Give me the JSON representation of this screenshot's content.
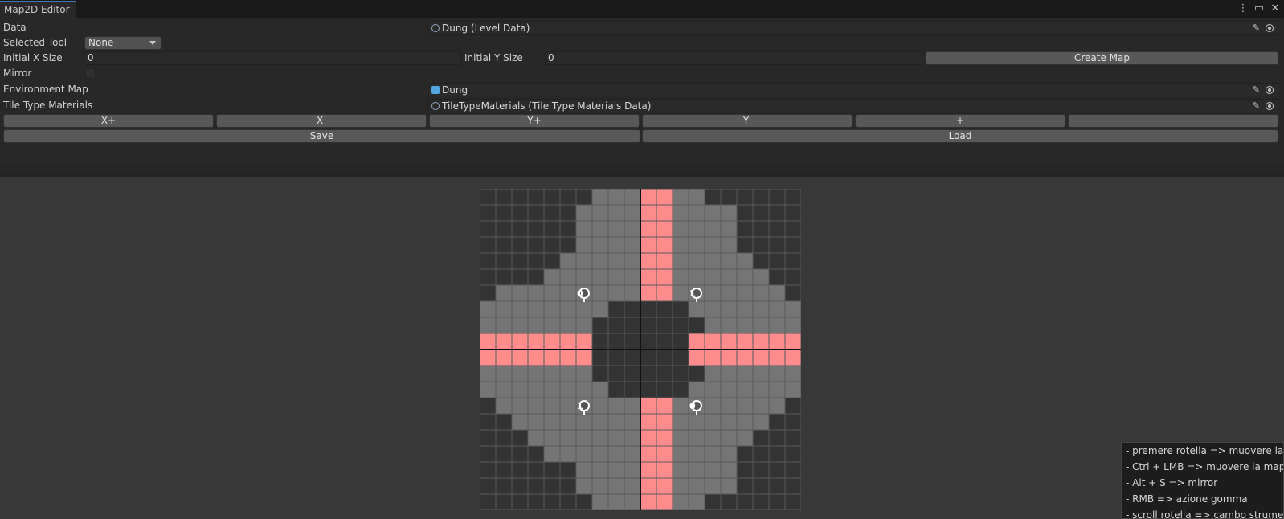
{
  "window": {
    "tab_title": "Map2D Editor",
    "icons": [
      "more-vertical-icon",
      "maximize-icon",
      "close-icon"
    ]
  },
  "inspector": {
    "data_label": "Data",
    "data_value": "Dung (Level Data)",
    "selected_tool_label": "Selected Tool",
    "selected_tool_value": "None",
    "initial_x_label": "Initial X Size",
    "initial_x_value": "0",
    "initial_y_label": "Initial Y Size",
    "initial_y_value": "0",
    "create_map_label": "Create Map",
    "mirror_label": "Mirror",
    "mirror_checked": false,
    "env_map_label": "Environment Map",
    "env_map_value": "Dung",
    "tile_materials_label": "Tile Type Materials",
    "tile_materials_value": "TileTypeMaterials (Tile Type Materials Data)",
    "resize_buttons": [
      "X+",
      "X-",
      "Y+",
      "Y-",
      "+",
      "-"
    ],
    "save_label": "Save",
    "load_label": "Load"
  },
  "map": {
    "columns": 20,
    "rows": 20,
    "colors": {
      "dark": "#333333",
      "floor": "#757575",
      "corridor": "#ff8c8c",
      "gridline": "#5a5a5a"
    },
    "rows_data": [
      "DDDDDDDFFFRRFFDDDDDD",
      "DDDDDDFFFFRRFFFFDDDD",
      "DDDDDDFFFFRRFFFFDDDD",
      "DDDDDDFFFFRRFFFFDDDD",
      "DDDDDFFFFFRRFFFFFDDD",
      "DDDDFFFFFFRRFFFFFFDD",
      "DFFFFFFFFFRRFFFFFFFD",
      "FFFFFFFFDDDDDFFFFFFF",
      "FFFFFFFDDDDDDDFFFFFF",
      "RRRRRRRDDDDDDRRRRRRR",
      "RRRRRRRDDDDDDRRRRRRR",
      "FFFFFFFDDDDDDDFFFFFF",
      "FFFFFFFFDDDDDFFFFFFF",
      "DFFFFFFFFFRRFFFFFFFD",
      "DDFFFFFFFFRRFFFFFFDD",
      "DDDFFFFFFFRRFFFFFDDD",
      "DDDDFFFFFFRRFFFFDDDD",
      "DDDDDDFFFFRRFFFFDDDD",
      "DDDDDDFFFFRRFFFFDDDD",
      "DDDDDDDFFFRRFFDDDDDD"
    ],
    "markers": [
      {
        "label": "0",
        "col": 6.5,
        "row": 6.5
      },
      {
        "label": "1",
        "col": 13.5,
        "row": 6.5
      },
      {
        "label": "1",
        "col": 6.5,
        "row": 13.5
      },
      {
        "label": "0",
        "col": 13.5,
        "row": 13.5
      }
    ]
  },
  "help": {
    "lines": [
      "- premere rotella => muovere la ma",
      "- Ctrl + LMB => muovere la mappa",
      "- Alt + S => mirror",
      "- RMB => azione gomma",
      "- scroll rotella => cambo strumento"
    ]
  }
}
